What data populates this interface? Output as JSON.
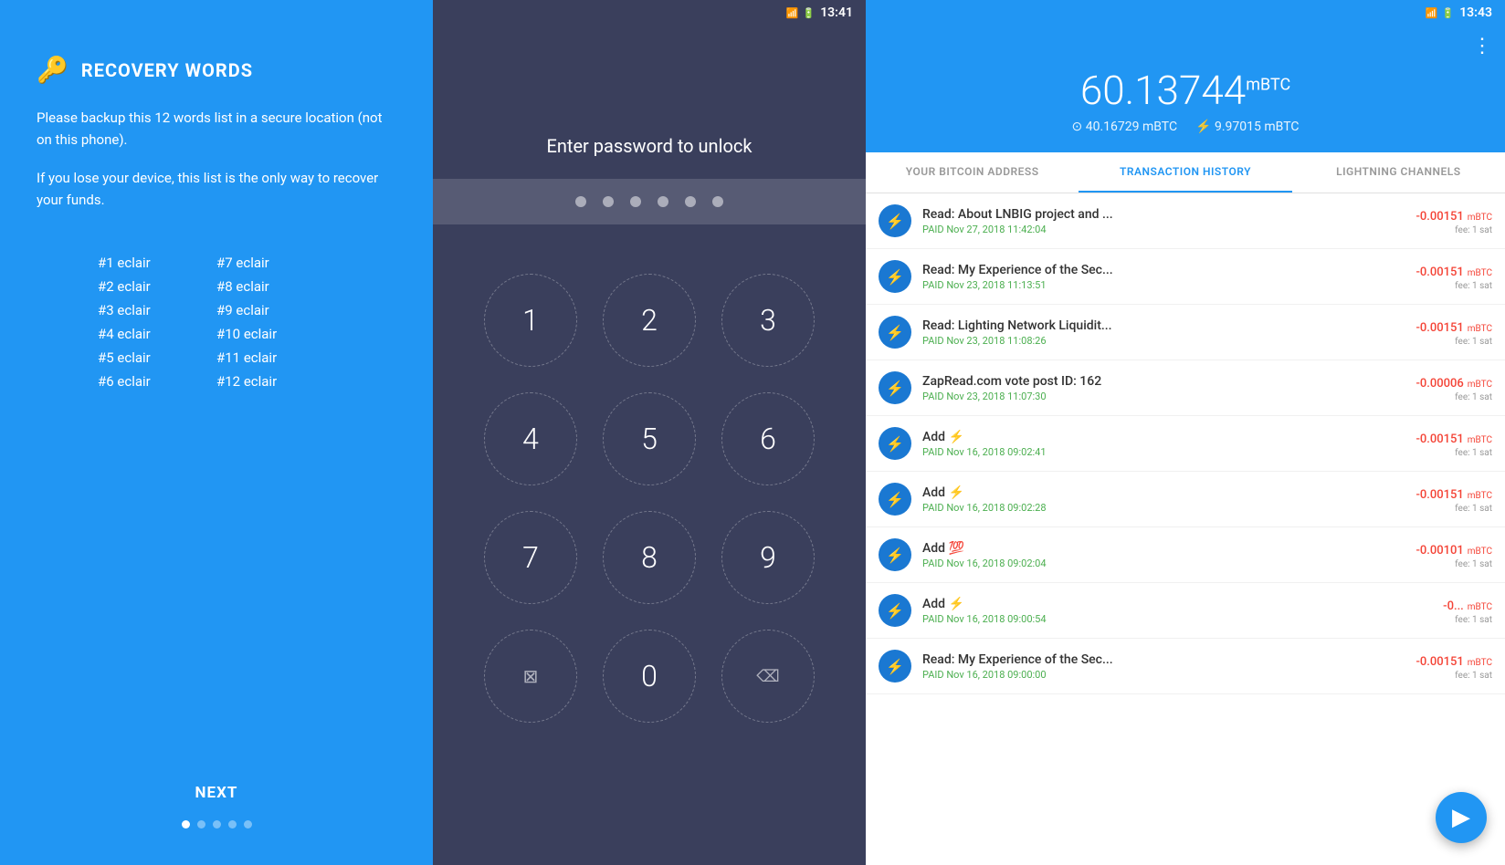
{
  "screen1": {
    "title": "RECOVERY WORDS",
    "desc1": "Please backup this 12 words list in a secure location (not on this phone).",
    "desc2": "If you lose your device, this list is the only way to recover your funds.",
    "words": [
      {
        "num": "#1",
        "word": "eclair"
      },
      {
        "num": "#7",
        "word": "eclair"
      },
      {
        "num": "#2",
        "word": "eclair"
      },
      {
        "num": "#8",
        "word": "eclair"
      },
      {
        "num": "#3",
        "word": "eclair"
      },
      {
        "num": "#9",
        "word": "eclair"
      },
      {
        "num": "#4",
        "word": "eclair"
      },
      {
        "num": "#10",
        "word": "eclair"
      },
      {
        "num": "#5",
        "word": "eclair"
      },
      {
        "num": "#11",
        "word": "eclair"
      },
      {
        "num": "#6",
        "word": "eclair"
      },
      {
        "num": "#12",
        "word": "eclair"
      }
    ],
    "next_label": "NEXT",
    "dots": [
      true,
      false,
      false,
      false,
      false
    ]
  },
  "screen2": {
    "status_time": "13:41",
    "unlock_label": "Enter password to unlock",
    "pin_dots": 6,
    "numpad": [
      "1",
      "2",
      "3",
      "4",
      "5",
      "6",
      "7",
      "8",
      "9",
      "",
      "0",
      "⌫"
    ]
  },
  "screen3": {
    "status_time": "13:43",
    "balance_main": "60.13744",
    "balance_unit": "mBTC",
    "balance_onchain": "40.16729 mBTC",
    "balance_lightning": "9.97015 mBTC",
    "tabs": [
      {
        "label": "YOUR BITCOIN ADDRESS",
        "active": false
      },
      {
        "label": "TRANSACTION HISTORY",
        "active": true
      },
      {
        "label": "LIGHTNING CHANNELS",
        "active": false
      }
    ],
    "transactions": [
      {
        "title": "Read: About LNBIG project and ...",
        "date": "PAID Nov 27, 2018 11:42:04",
        "amount": "-0.00151",
        "unit": "mBTC",
        "fee": "fee: 1 sat"
      },
      {
        "title": "Read: My Experience of the Sec...",
        "date": "PAID Nov 23, 2018 11:13:51",
        "amount": "-0.00151",
        "unit": "mBTC",
        "fee": "fee: 1 sat"
      },
      {
        "title": "Read: Lighting Network Liquidit...",
        "date": "PAID Nov 23, 2018 11:08:26",
        "amount": "-0.00151",
        "unit": "mBTC",
        "fee": "fee: 1 sat"
      },
      {
        "title": "ZapRead.com vote post ID: 162",
        "date": "PAID Nov 23, 2018 11:07:30",
        "amount": "-0.00006",
        "unit": "mBTC",
        "fee": "fee: 1 sat"
      },
      {
        "title": "Add ⚡",
        "date": "PAID Nov 16, 2018 09:02:41",
        "amount": "-0.00151",
        "unit": "mBTC",
        "fee": "fee: 1 sat"
      },
      {
        "title": "Add ⚡",
        "date": "PAID Nov 16, 2018 09:02:28",
        "amount": "-0.00151",
        "unit": "mBTC",
        "fee": "fee: 1 sat"
      },
      {
        "title": "Add 💯",
        "date": "PAID Nov 16, 2018 09:02:04",
        "amount": "-0.00101",
        "unit": "mBTC",
        "fee": "fee: 1 sat"
      },
      {
        "title": "Add ⚡",
        "date": "PAID Nov 16, 2018 09:00:54",
        "amount": "-0...",
        "unit": "mBTC",
        "fee": "fee: 1 sat"
      },
      {
        "title": "Read: My Experience of the Sec...",
        "date": "PAID Nov 16, 2018 09:00:00",
        "amount": "-0.00151",
        "unit": "mBTC",
        "fee": "fee: 1 sat"
      }
    ]
  }
}
